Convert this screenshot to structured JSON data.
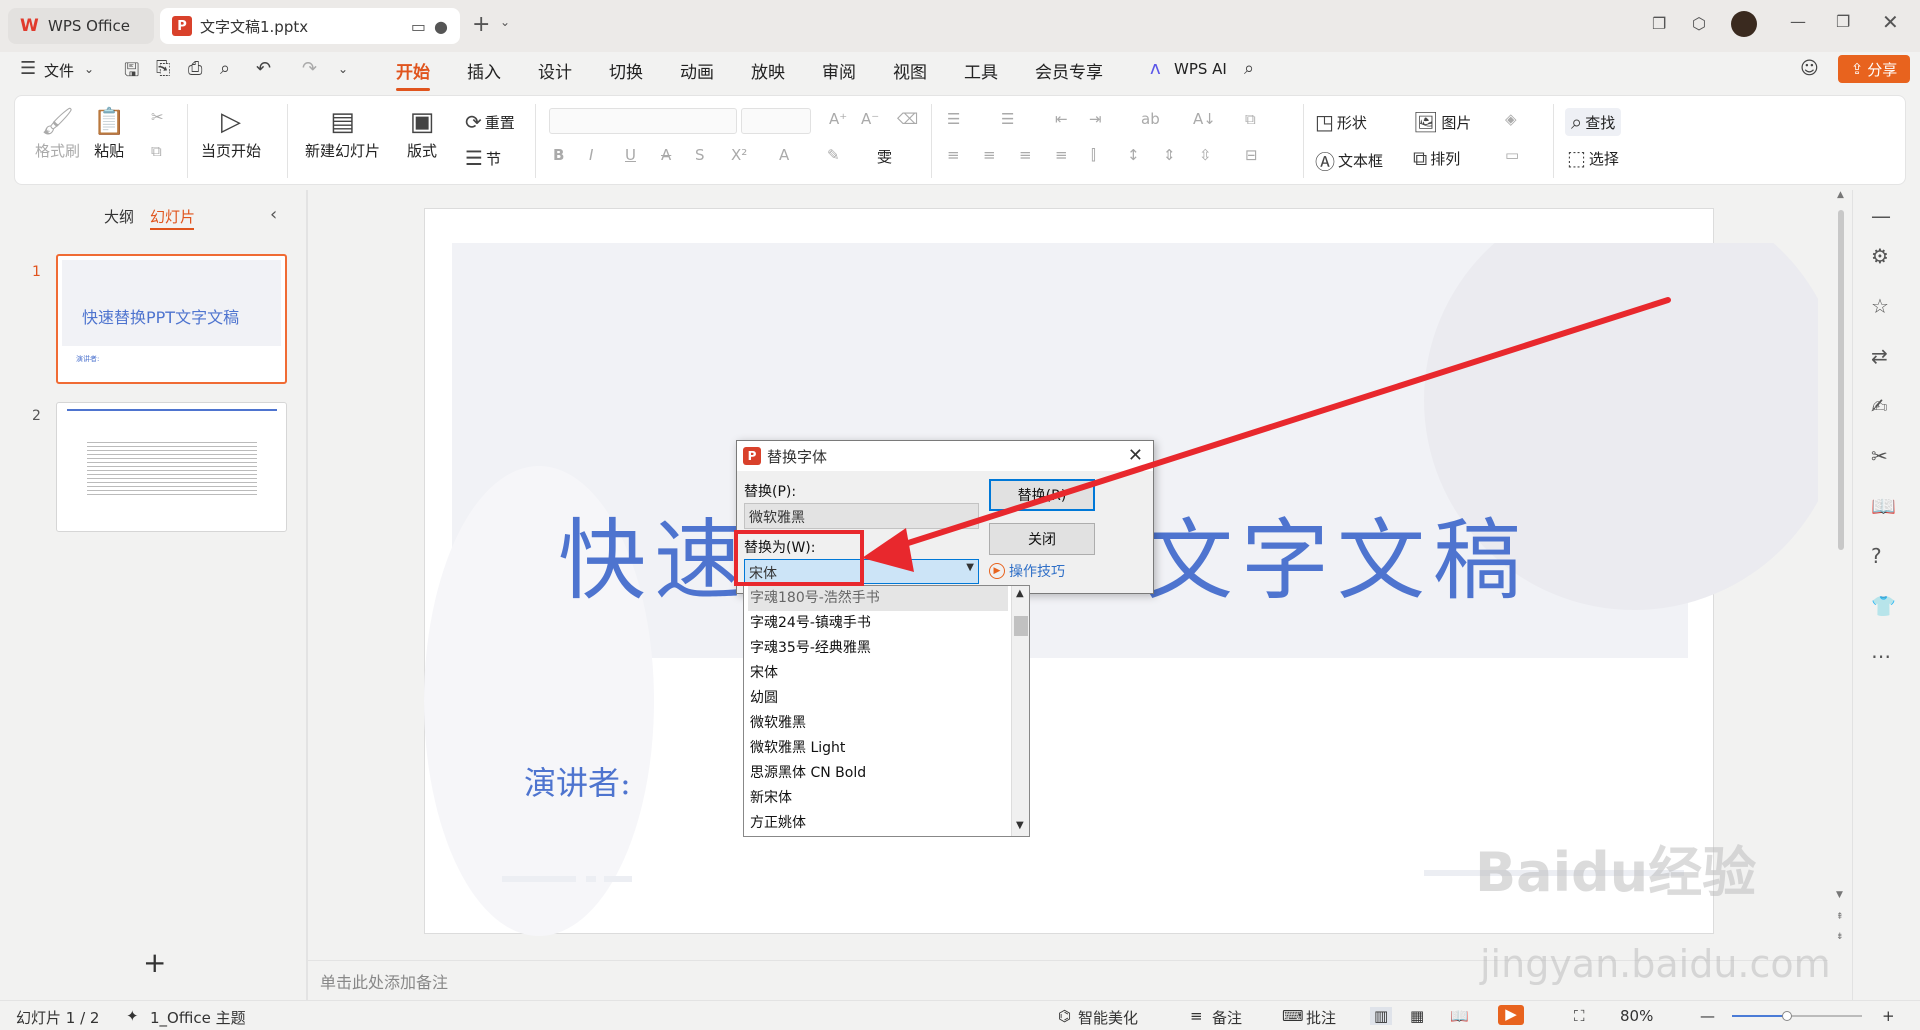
{
  "tabs": {
    "home_label": "WPS Office",
    "doc_label": "文字文稿1.pptx",
    "doc_icon": "P"
  },
  "menu": {
    "file": "文件",
    "items": [
      "开始",
      "插入",
      "设计",
      "切换",
      "动画",
      "放映",
      "审阅",
      "视图",
      "工具",
      "会员专享"
    ],
    "active": "开始",
    "ai": "WPS AI",
    "share": "分享"
  },
  "ribbon": {
    "format_painter": "格式刷",
    "paste": "粘贴",
    "from_current": "当页开始",
    "new_slide": "新建幻灯片",
    "layout": "版式",
    "reset": "重置",
    "section": "节",
    "shape": "形状",
    "picture": "图片",
    "textbox": "文本框",
    "arrange": "排列",
    "find": "查找",
    "select": "选择"
  },
  "left_panel": {
    "tab_outline": "大纲",
    "tab_slides": "幻灯片",
    "slide1_num": "1",
    "slide1_title": "快速替换PPT文字文稿",
    "slide1_sub": "演讲者:",
    "slide2_num": "2",
    "add": "+"
  },
  "slide": {
    "title_left": "快速",
    "title_right": "文字文稿",
    "speaker": "演讲者:"
  },
  "notes_placeholder": "单击此处添加备注",
  "dialog": {
    "title": "替换字体",
    "replace_label": "替换(P):",
    "replace_value": "微软雅黑",
    "with_label": "替换为(W):",
    "with_value": "宋体",
    "replace_button": "替换(R)",
    "close_button": "关闭",
    "tips": "操作技巧"
  },
  "font_list": [
    "字魂180号-浩然手书",
    "字魂24号-镇魂手书",
    "字魂35号-经典雅黑",
    "宋体",
    "幼圆",
    "微软雅黑",
    "微软雅黑 Light",
    "思源黑体 CN Bold",
    "新宋体",
    "方正姚体"
  ],
  "status": {
    "slide_count": "幻灯片 1 / 2",
    "theme": "1_Office 主题",
    "smart": "智能美化",
    "notes": "备注",
    "comment": "批注",
    "zoom": "80%"
  },
  "watermark": {
    "main": "Baidu经验",
    "sub": "jingyan.baidu.com"
  },
  "colors": {
    "accent": "#e0541d",
    "title_blue": "#4e74cf",
    "highlight_red": "#e8282d"
  }
}
